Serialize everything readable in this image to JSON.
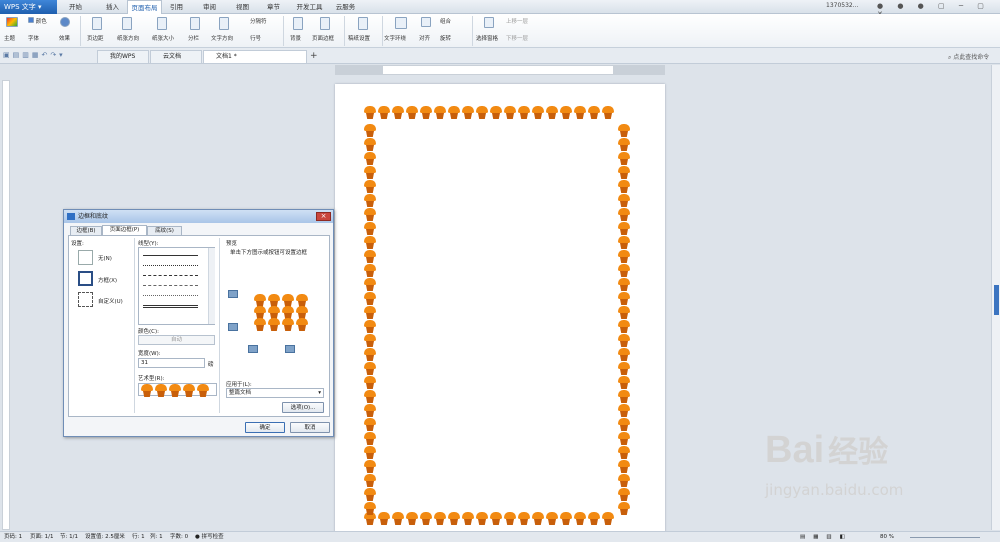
{
  "app": {
    "title": "WPS 文字",
    "account": "1370532..."
  },
  "menu_tabs": [
    "开始",
    "插入",
    "页面布局",
    "引用",
    "审阅",
    "视图",
    "章节",
    "开发工具",
    "云服务"
  ],
  "menu_active": "页面布局",
  "ribbon": {
    "theme": "主题",
    "colors": "颜色",
    "fonts": "字体",
    "effects": "效果",
    "margins": "页边距",
    "orientation": "纸张方向",
    "size": "纸张大小",
    "columns": "分栏",
    "text_direction": "文字方向",
    "line_numbers": "行号",
    "breaks": "分隔符",
    "background": "背景",
    "page_border": "页面边框",
    "manuscript": "稿纸设置",
    "wrap": "文字环绕",
    "align": "对齐",
    "rotate": "旋转",
    "group": "组合",
    "selection_pane": "选择窗格",
    "bring_forward": "上移一层",
    "send_backward": "下移一层"
  },
  "doc_tabs": [
    "我的WPS",
    "云文档",
    "文档1 *"
  ],
  "search_placeholder": "点此查找命令",
  "dialog": {
    "title": "边框和底纹",
    "tabs": [
      "边框(B)",
      "页面边框(P)",
      "底纹(S)"
    ],
    "active_tab": "页面边框(P)",
    "setting_label": "设置:",
    "settings": [
      "无(N)",
      "方框(X)",
      "自定义(U)"
    ],
    "style_label": "线型(Y):",
    "color_label": "颜色(C):",
    "color_value": "自动",
    "width_label": "宽度(W):",
    "width_value": "31",
    "width_unit": "磅",
    "art_label": "艺术型(R):",
    "preview_label": "预览",
    "preview_hint": "单击下方图示或按钮可设置边框",
    "apply_label": "应用于(L):",
    "apply_value": "整篇文档",
    "options_button": "选项(O)...",
    "ok_button": "确定",
    "cancel_button": "取消"
  },
  "status": {
    "page": "页码: 1",
    "pages": "页面: 1/1",
    "section": "节: 1/1",
    "position": "设置值: 2.5厘米",
    "line": "行: 1",
    "column": "列: 1",
    "words": "字数: 0",
    "spell": "拼写检查",
    "zoom": "80 %"
  },
  "watermark": {
    "brand": "Bai",
    "brand2": "经验",
    "url": "jingyan.baidu.com"
  },
  "colors": {
    "accent": "#1f5fae",
    "pot": "#f28a12",
    "pot_dark": "#c85f0a"
  }
}
